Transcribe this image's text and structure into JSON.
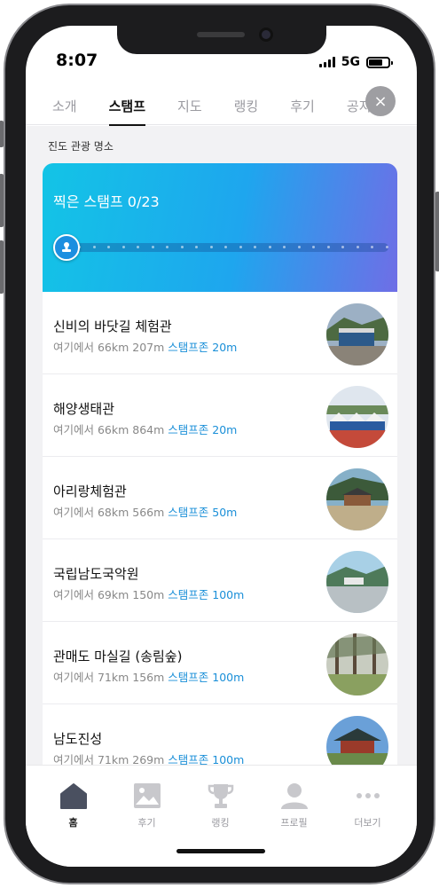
{
  "status_bar": {
    "time": "8:07",
    "network": "5G"
  },
  "tabs": [
    {
      "label": "소개",
      "active": false
    },
    {
      "label": "스탬프",
      "active": true
    },
    {
      "label": "지도",
      "active": false
    },
    {
      "label": "랭킹",
      "active": false
    },
    {
      "label": "후기",
      "active": false
    },
    {
      "label": "공지",
      "active": false
    }
  ],
  "close_button_label": "×",
  "section_title": "진도 관광 명소",
  "stamp_card": {
    "title": "찍은 스탬프 0/23",
    "collected": 0,
    "total": 23
  },
  "places": [
    {
      "name": "신비의 바닷길 체험관",
      "distance": "여기에서 66km 207m",
      "zone": "스탬프존 20m"
    },
    {
      "name": "해양생태관",
      "distance": "여기에서 66km 864m",
      "zone": "스탬프존 20m"
    },
    {
      "name": "아리랑체험관",
      "distance": "여기에서 68km 566m",
      "zone": "스탬프존 50m"
    },
    {
      "name": "국립남도국악원",
      "distance": "여기에서 69km 150m",
      "zone": "스탬프존 100m"
    },
    {
      "name": "관매도 마실길 (송림숲)",
      "distance": "여기에서 71km 156m",
      "zone": "스탬프존 100m"
    },
    {
      "name": "남도진성",
      "distance": "여기에서 71km 269m",
      "zone": "스탬프존 100m"
    }
  ],
  "bottom_nav": [
    {
      "label": "홈",
      "icon": "home-icon",
      "active": true
    },
    {
      "label": "후기",
      "icon": "image-icon",
      "active": false
    },
    {
      "label": "랭킹",
      "icon": "trophy-icon",
      "active": false
    },
    {
      "label": "프로필",
      "icon": "person-icon",
      "active": false
    },
    {
      "label": "더보기",
      "icon": "more-icon",
      "active": false
    }
  ],
  "colors": {
    "accent": "#1a8fd8",
    "card_start": "#13c4e6",
    "card_end": "#6f6ee6"
  }
}
